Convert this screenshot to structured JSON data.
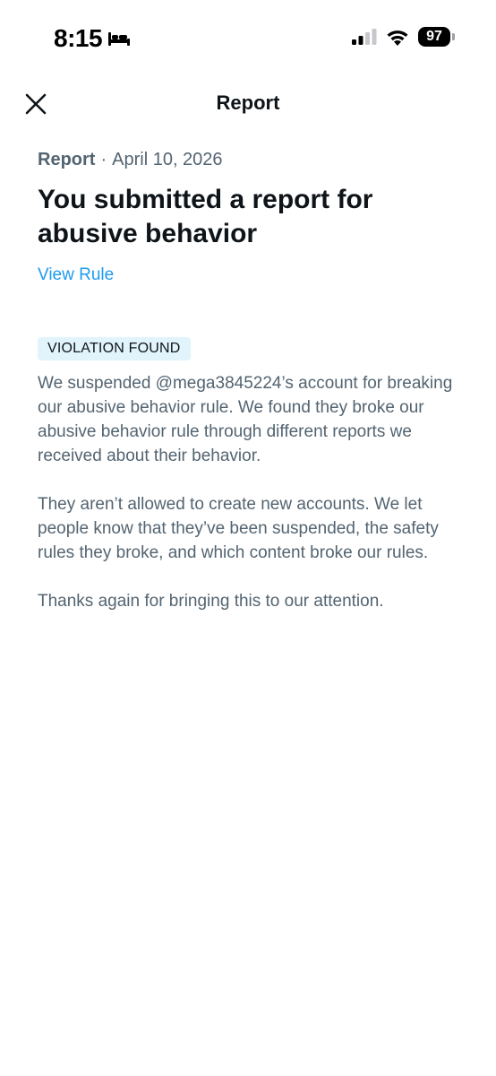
{
  "status_bar": {
    "time": "8:15",
    "battery": "97",
    "icons": [
      "bed-icon",
      "cellular-signal-icon",
      "wifi-icon",
      "battery-icon"
    ]
  },
  "header": {
    "title": "Report",
    "close_icon": "close-icon"
  },
  "report": {
    "label": "Report",
    "separator": "·",
    "date": "April 10, 2026",
    "headline": "You submitted a report for abusive behavior",
    "view_rule_label": "View Rule",
    "status_badge": "VIOLATION FOUND",
    "paragraphs": [
      "We suspended @mega3845224’s account for breaking our abusive behavior rule. We found they broke our abusive behavior rule through different reports we received about their behavior.",
      "They aren’t allowed to create new accounts. We let people know that they’ve been suspended, the safety rules they broke, and which content broke our rules.",
      "Thanks again for bringing this to our attention."
    ]
  },
  "colors": {
    "text_primary": "#0f1419",
    "text_secondary": "#536471",
    "link": "#1d9bf0",
    "badge_bg": "#e1f4fc"
  }
}
